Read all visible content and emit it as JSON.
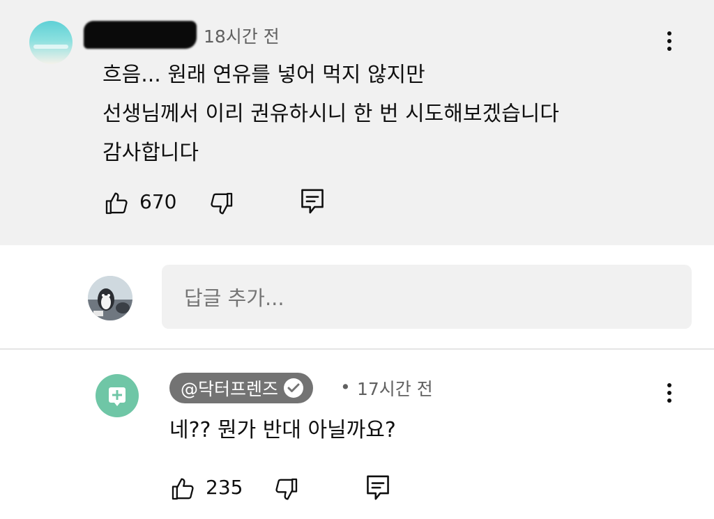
{
  "top_comment": {
    "time": "18시간 전",
    "lines": [
      "흐음... 원래 연유를 넣어 먹지 않지만",
      "선생님께서 이리 권유하시니 한 번 시도해보겠습니다",
      "감사합니다"
    ],
    "likes": "670"
  },
  "reply_input": {
    "placeholder": "답글 추가..."
  },
  "reply": {
    "channel": "@닥터프렌즈",
    "separator": "•",
    "time": "17시간 전",
    "text": "네?? 뭔가 반대 아닐까요?",
    "likes": "235"
  },
  "icons": {
    "like": "thumbs-up-icon",
    "dislike": "thumbs-down-icon",
    "reply": "comment-icon",
    "menu": "more-vertical-icon",
    "verified": "check-circle-icon"
  },
  "colors": {
    "highlight_bg": "#f1f1f1",
    "badge_bg": "#737373",
    "reply_avatar": "#6fc6a6",
    "meta_text": "#606060"
  }
}
